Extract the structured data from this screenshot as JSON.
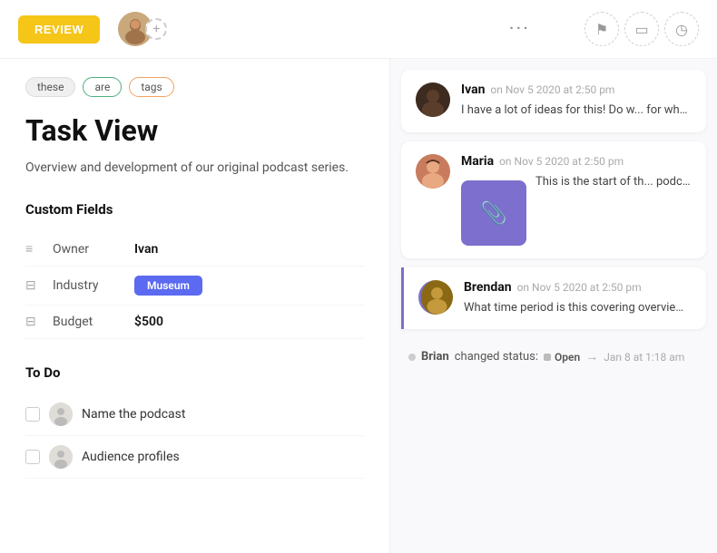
{
  "header": {
    "review_label": "REVIEW",
    "dots": "···",
    "icons": [
      "flag-icon",
      "calendar-icon",
      "clock-icon"
    ]
  },
  "tags": [
    {
      "label": "these",
      "style": "these"
    },
    {
      "label": "are",
      "style": "are"
    },
    {
      "label": "tags",
      "style": "tags"
    }
  ],
  "page": {
    "title": "Task View",
    "description": "Overview and development of our original podcast series."
  },
  "custom_fields": {
    "section_title": "Custom Fields",
    "fields": [
      {
        "icon": "≡",
        "label": "Owner",
        "value": "Ivan",
        "type": "text"
      },
      {
        "icon": "⊟",
        "label": "Industry",
        "value": "Museum",
        "type": "badge"
      },
      {
        "icon": "⊟",
        "label": "Budget",
        "value": "$500",
        "type": "text"
      }
    ]
  },
  "todo": {
    "section_title": "To Do",
    "items": [
      {
        "text": "Name the podcast"
      },
      {
        "text": "Audience profiles"
      }
    ]
  },
  "comments": [
    {
      "author": "Ivan",
      "time": "on Nov 5 2020 at 2:50 pm",
      "text": "I have a lot of ideas for this! Do what the development plan e...",
      "avatar_type": "ivan",
      "avatar_emoji": "👨"
    },
    {
      "author": "Maria",
      "time": "on Nov 5 2020 at 2:50 pm",
      "text": "This is the start of th... podcast, let me kno...",
      "avatar_type": "maria",
      "avatar_emoji": "👩",
      "has_attachment": true
    },
    {
      "author": "Brendan",
      "time": "on Nov 5 2020 at 2:50 pm",
      "text": "What time period is this covering overview to include a date range...",
      "avatar_type": "brendan",
      "avatar_emoji": "👨",
      "left_accent": true
    }
  ],
  "status_change": {
    "author": "Brian",
    "action": "changed status:",
    "from": "Open",
    "arrow": "→",
    "time": "Jan 8 at 1:18 am"
  }
}
